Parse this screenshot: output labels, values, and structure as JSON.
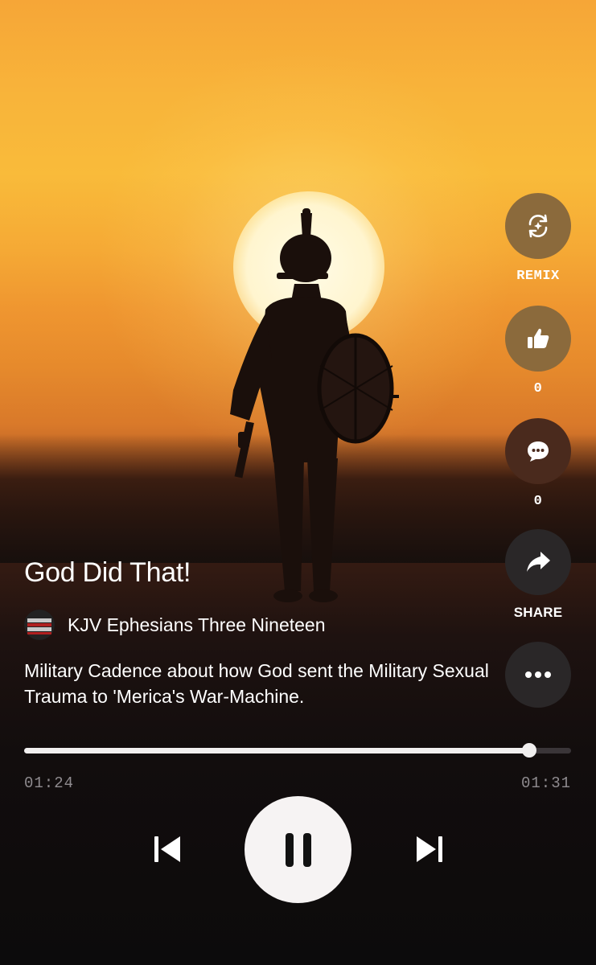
{
  "song": {
    "title": "God Did That!",
    "author": "KJV Ephesians Three Nineteen",
    "description": "Military Cadence about how God sent the Military Sexual Trauma to 'Merica's War-Machine.",
    "avatar_text": "CHRISTIANS CAUSED ABORTION BY WELCOMING"
  },
  "actions": {
    "remix": {
      "label": "REMIX",
      "icon": "remix-icon"
    },
    "like": {
      "count": "0",
      "icon": "thumbs-up-icon"
    },
    "comment": {
      "count": "0",
      "icon": "comment-icon"
    },
    "share": {
      "label": "SHARE",
      "icon": "share-icon"
    },
    "more": {
      "icon": "more-icon"
    }
  },
  "player": {
    "elapsed": "01:24",
    "duration": "01:31",
    "progress": 0.923,
    "state": "playing",
    "prev_icon": "skip-previous-icon",
    "pause_icon": "pause-icon",
    "next_icon": "skip-next-icon"
  },
  "colors": {
    "action_remix_like": "#8b6a3c",
    "action_comment": "#4a2a1d",
    "action_share_more": "#2a2728"
  }
}
